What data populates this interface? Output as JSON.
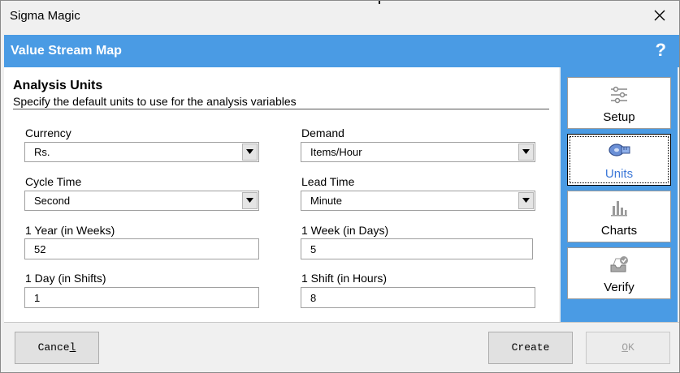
{
  "window": {
    "title": "Sigma Magic"
  },
  "header": {
    "title": "Value Stream Map",
    "help": "?"
  },
  "section": {
    "title": "Analysis Units",
    "description": "Specify the default units to use for the analysis variables"
  },
  "fields": {
    "currency": {
      "label": "Currency",
      "value": "Rs."
    },
    "demand": {
      "label": "Demand",
      "value": "Items/Hour"
    },
    "cycle_time": {
      "label": "Cycle Time",
      "value": "Second"
    },
    "lead_time": {
      "label": "Lead Time",
      "value": "Minute"
    },
    "year_weeks": {
      "label": "1 Year (in Weeks)",
      "value": "52"
    },
    "week_days": {
      "label": "1 Week (in Days)",
      "value": "5"
    },
    "day_shifts": {
      "label": "1 Day (in Shifts)",
      "value": "1"
    },
    "shift_hours": {
      "label": "1 Shift (in Hours)",
      "value": "8"
    }
  },
  "nav": {
    "items": [
      {
        "label": "Setup",
        "icon": "sliders-icon"
      },
      {
        "label": "Units",
        "icon": "measuring-tape-icon",
        "active": true
      },
      {
        "label": "Charts",
        "icon": "bar-chart-icon"
      },
      {
        "label": "Verify",
        "icon": "verify-icon"
      }
    ]
  },
  "footer": {
    "cancel": {
      "label_pre": "Cance",
      "label_ul": "l"
    },
    "create": {
      "label": "Create"
    },
    "ok": {
      "label_ul": "O",
      "label_post": "K",
      "disabled": true
    }
  },
  "colors": {
    "accent": "#4a9be4",
    "active_label": "#3c78d8"
  }
}
